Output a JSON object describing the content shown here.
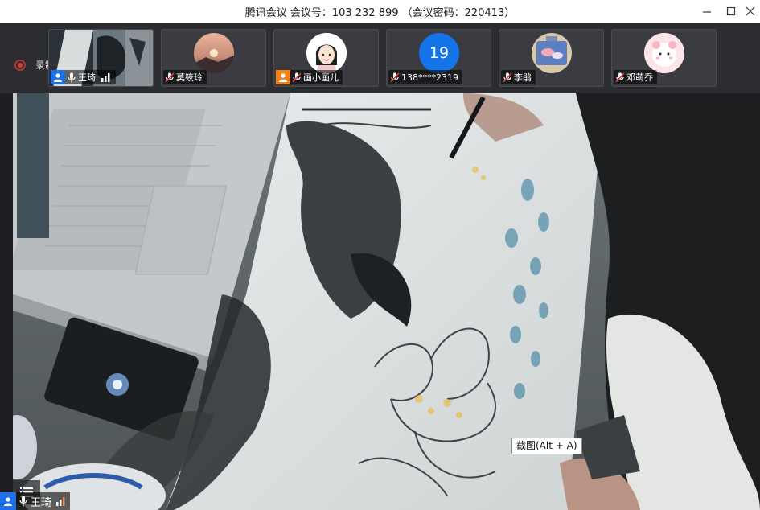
{
  "window": {
    "title": "腾讯会议 会议号：103 232 899 （会议密码：220413）",
    "controls": [
      "minimize",
      "maximize",
      "close"
    ]
  },
  "recording": {
    "label": "录制中"
  },
  "participants": [
    {
      "name": "王琦",
      "role": "host",
      "muted": false,
      "video": true
    },
    {
      "name": "莫筱玲",
      "role": "participant",
      "muted": true
    },
    {
      "name": "画小画儿",
      "role": "guest",
      "muted": true
    },
    {
      "name": "138****2319",
      "role": "participant",
      "muted": true,
      "avatar_text": "19"
    },
    {
      "name": "李鹃",
      "role": "participant",
      "muted": true
    },
    {
      "name": "邓萌乔",
      "role": "participant",
      "muted": true
    }
  ],
  "main_video": {
    "speaker_name": "王琦"
  },
  "tooltip": {
    "text": "截图(Alt + A)"
  },
  "colors": {
    "host_badge": "#1f6fe5",
    "guest_badge": "#f0831e",
    "record_red": "#d8413a",
    "strip_bg": "#2b2d31"
  }
}
